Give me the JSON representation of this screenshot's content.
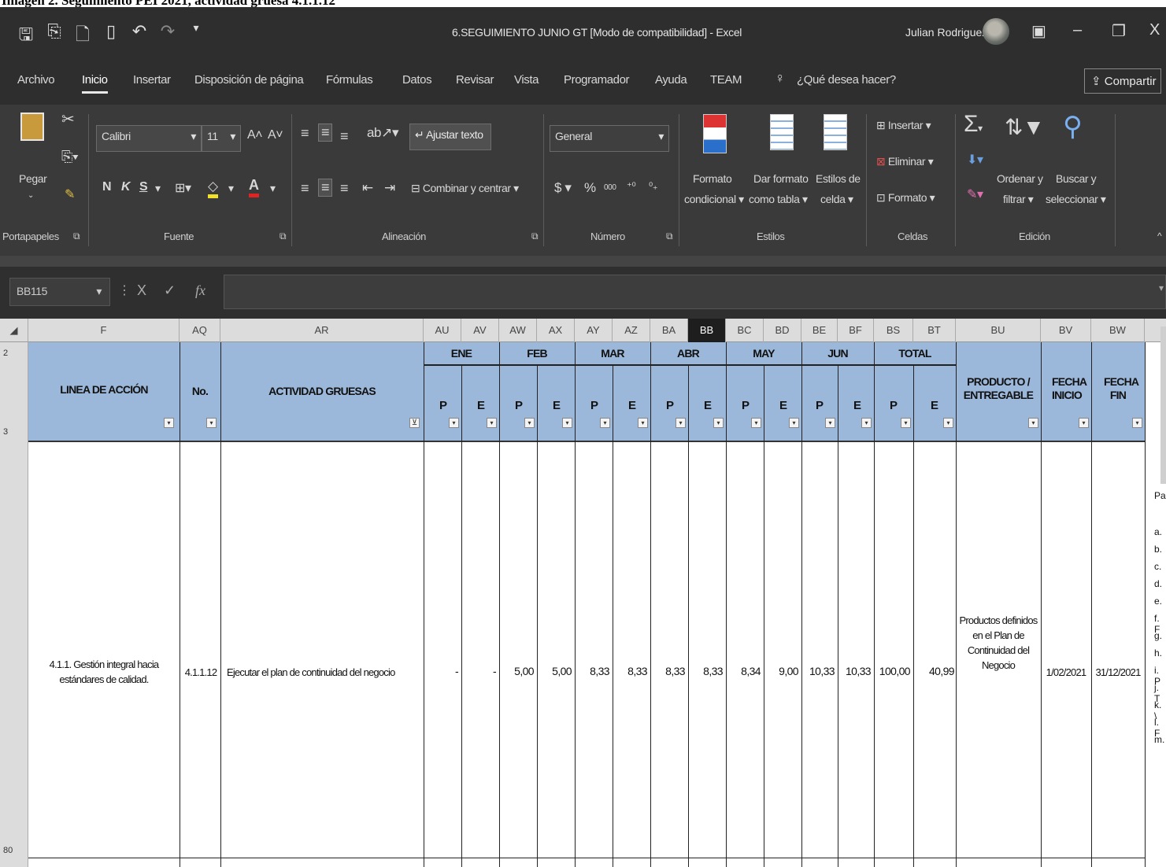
{
  "caption": "Imagen 2. Seguimiento PEI 2021, actividad gruesa 4.1.1.12",
  "window": {
    "title": "6.SEGUIMIENTO JUNIO GT [Modo de compatibilidad] - Excel",
    "user": "Julian Rodriguez"
  },
  "tabs": [
    "Archivo",
    "Inicio",
    "Insertar",
    "Disposición de página",
    "Fórmulas",
    "Datos",
    "Revisar",
    "Vista",
    "Programador",
    "Ayuda",
    "TEAM"
  ],
  "active_tab": "Inicio",
  "tell_me": "¿Qué desea hacer?",
  "share": "Compartir",
  "ribbon": {
    "paste": "Pegar",
    "font_name": "Calibri",
    "font_size": "11",
    "bold": "N",
    "italic": "K",
    "underline": "S",
    "wrap_text": "Ajustar texto",
    "merge_center": "Combinar y centrar",
    "number_format": "General",
    "currency": "$",
    "percent": "%",
    "thousands": "000",
    "cond_format_1": "Formato",
    "cond_format_2": "condicional",
    "table_format_1": "Dar formato",
    "table_format_2": "como tabla",
    "cell_styles_1": "Estilos de",
    "cell_styles_2": "celda",
    "insert": "Insertar",
    "delete": "Eliminar",
    "format": "Formato",
    "sort_1": "Ordenar y",
    "sort_2": "filtrar",
    "find_1": "Buscar y",
    "find_2": "seleccionar",
    "groups": [
      "Portapapeles",
      "Fuente",
      "Alineación",
      "Número",
      "Estilos",
      "Celdas",
      "Edición"
    ]
  },
  "formula_bar": {
    "name_box": "BB115",
    "fx": "fx",
    "cancel": "X",
    "enter": "✓"
  },
  "columns": [
    "F",
    "AQ",
    "AR",
    "AU",
    "AV",
    "AW",
    "AX",
    "AY",
    "AZ",
    "BA",
    "BB",
    "BC",
    "BD",
    "BE",
    "BF",
    "BS",
    "BT",
    "BU",
    "BV",
    "BW"
  ],
  "selected_column": "BB",
  "row_numbers": [
    "2",
    "3",
    "80"
  ],
  "headers": {
    "linea": "LINEA DE ACCIÓN",
    "no": "No.",
    "actividad": "ACTIVIDAD GRUESAS",
    "months": [
      "ENE",
      "FEB",
      "MAR",
      "ABR",
      "MAY",
      "JUN",
      "TOTAL"
    ],
    "p": "P",
    "e": "E",
    "producto": "PRODUCTO / ENTREGABLE",
    "fecha_inicio": "FECHA INICIO",
    "fecha_fin": "FECHA FIN"
  },
  "row": {
    "linea": "4.1.1. Gestión integral hacia estándares de calidad.",
    "no": "4.1.1.12",
    "actividad": "Ejecutar el plan de continuidad del negocio",
    "values": [
      "-",
      "-",
      "5,00",
      "5,00",
      "8,33",
      "8,33",
      "8,33",
      "8,33",
      "8,34",
      "9,00",
      "10,33",
      "10,33",
      "100,00",
      "40,99"
    ],
    "producto": "Productos definidos en el Plan de Continuidad del Negocio",
    "fecha_inicio": "1/02/2021",
    "fecha_fin": "31/12/2021",
    "side_text": [
      "Pa",
      "a.",
      "b.",
      "c.",
      "d.",
      "e.",
      "f. F",
      "g.",
      "h.",
      "i. P",
      "j. T",
      "k. \\",
      "l. F",
      "m."
    ]
  }
}
